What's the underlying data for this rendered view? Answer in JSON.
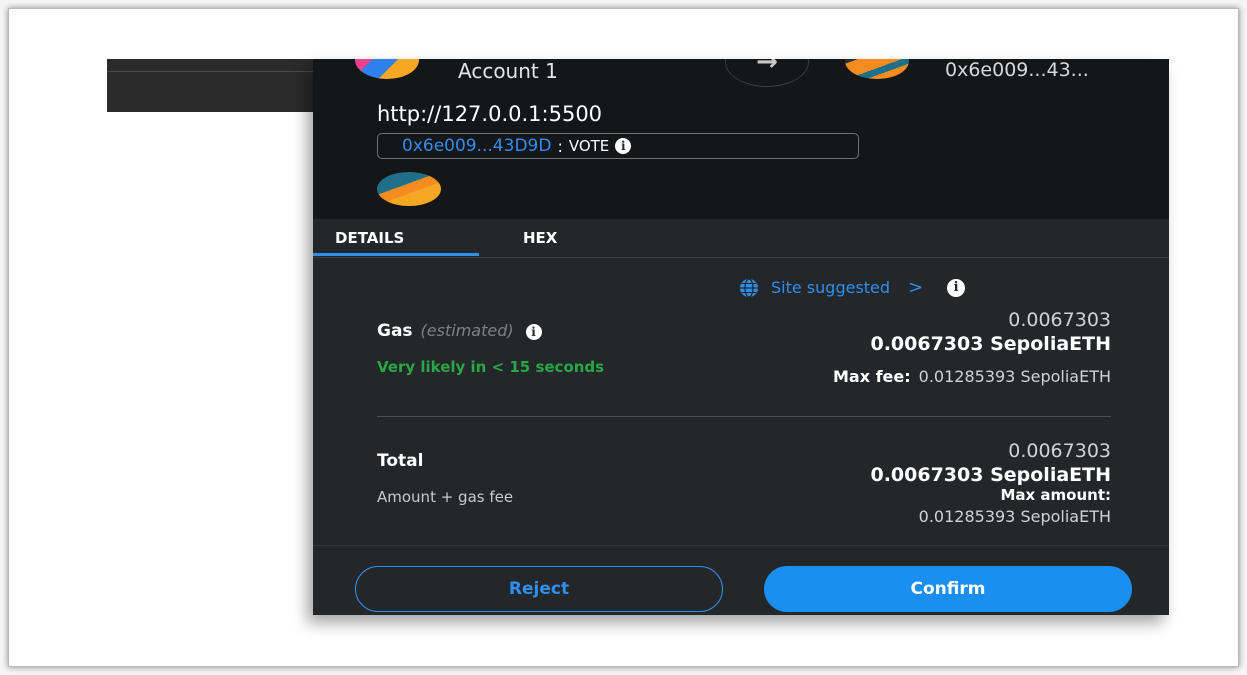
{
  "header": {
    "account_name": "Account 1",
    "target_address": "0x6e009...43...",
    "origin": "http://127.0.0.1:5500",
    "contract_address": "0x6e009...43D9D",
    "contract_separator": ":",
    "contract_method": "VOTE"
  },
  "tabs": [
    {
      "label": "DETAILS",
      "active": true
    },
    {
      "label": "HEX",
      "active": false
    }
  ],
  "gas": {
    "site_suggested": "Site suggested",
    "chevron": ">",
    "label": "Gas",
    "estimated": "(estimated)",
    "likely": "Very likely in < 15 seconds",
    "fiat_value": "0.0067303",
    "eth_value": "0.0067303 SepoliaETH",
    "max_fee_label": "Max fee:",
    "max_fee_value": "0.01285393 SepoliaETH"
  },
  "total": {
    "label": "Total",
    "sub": "Amount + gas fee",
    "fiat_value": "0.0067303",
    "eth_value": "0.0067303 SepoliaETH",
    "max_amount_label": "Max amount:",
    "max_amount_value": "0.01285393 SepoliaETH"
  },
  "buttons": {
    "reject": "Reject",
    "confirm": "Confirm"
  },
  "colors": {
    "accent": "#2f8ff0",
    "success": "#28a745",
    "panel": "#24272a",
    "header": "#141618"
  },
  "icons": [
    "arrow-right-icon",
    "info-icon",
    "globe-icon"
  ]
}
